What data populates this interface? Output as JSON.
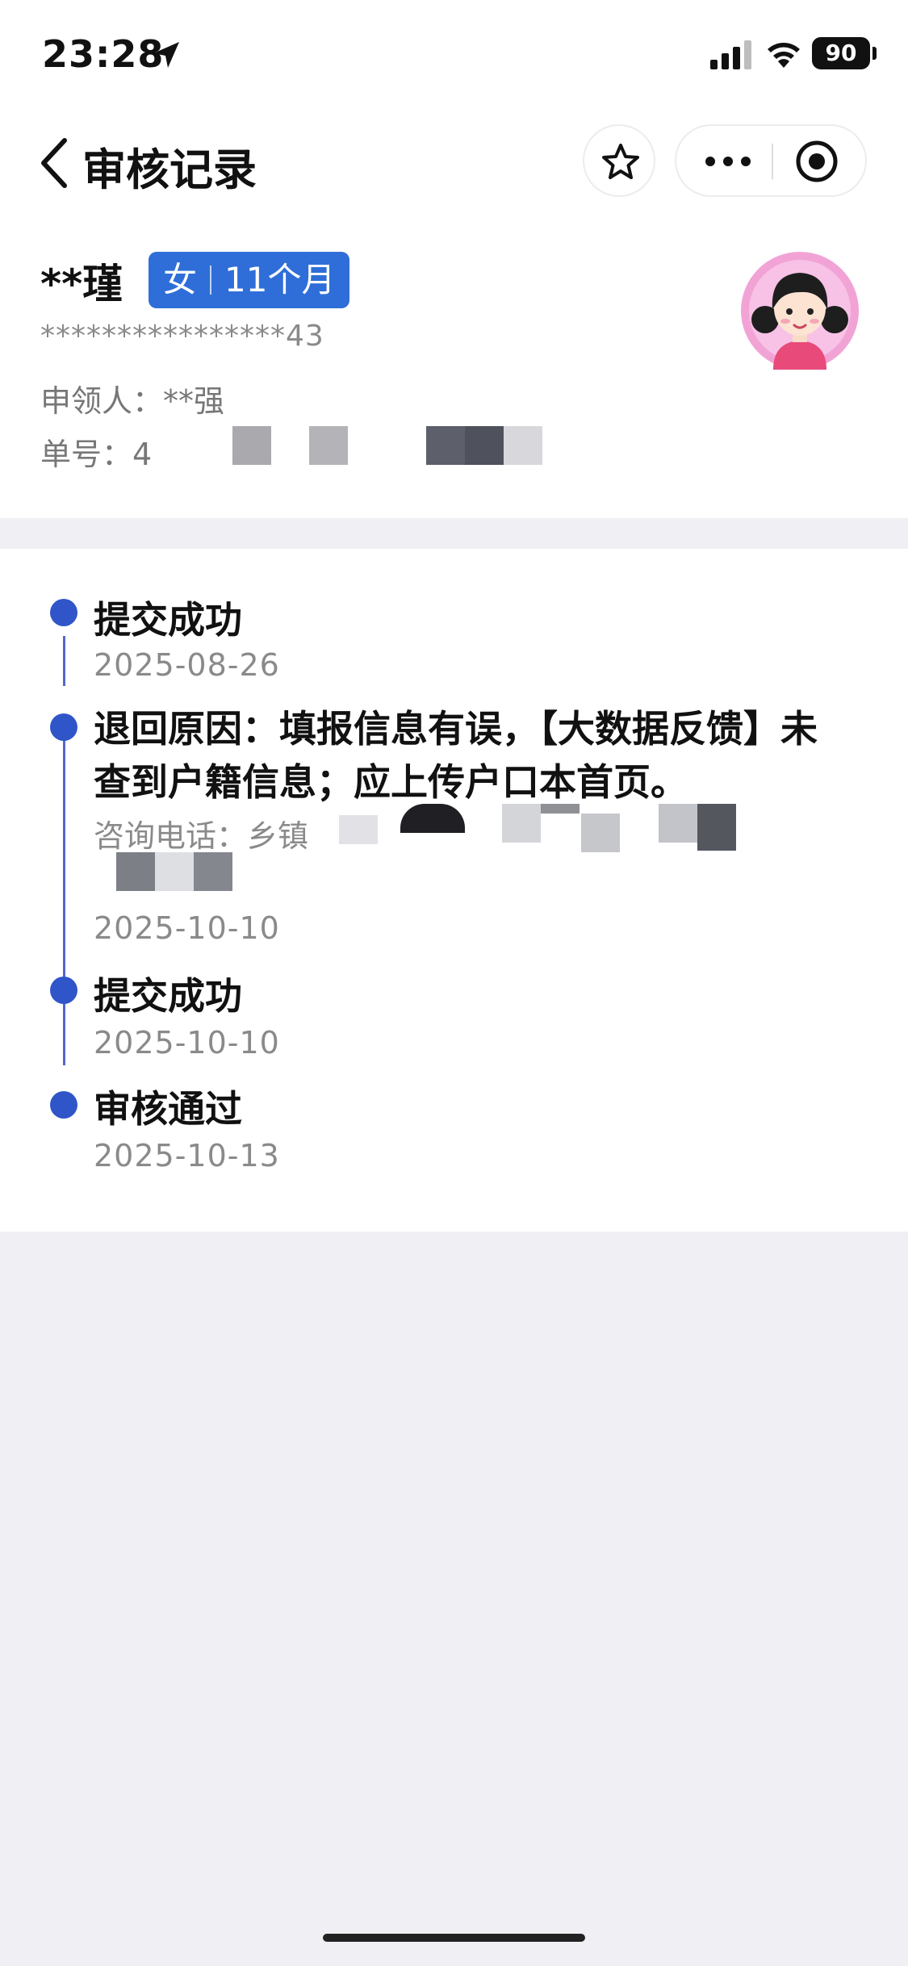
{
  "status_bar": {
    "time": "23:28",
    "battery": "90",
    "icons": [
      "location-arrow-icon",
      "signal-icon",
      "wifi-icon",
      "battery-icon"
    ]
  },
  "nav": {
    "title": "审核记录",
    "icons": [
      "back-chevron-icon",
      "star-icon",
      "more-icon",
      "target-icon"
    ]
  },
  "profile": {
    "name": "**瑾",
    "gender": "女",
    "age": "11个月",
    "id_number": "****************43",
    "applicant_label": "申领人：",
    "applicant_value": "**强",
    "order_label": "单号：",
    "order_value": "4",
    "tag_color": "#2f6ed8",
    "avatar": "girl-avatar-icon"
  },
  "timeline": {
    "accent_color": "#2f55c8",
    "items": [
      {
        "title": "提交成功",
        "date": "2025-08-26"
      },
      {
        "reason": "退回原因：填报信息有误，【大数据反馈】未查到户籍信息；应上传户口本首页。",
        "phone_label": "咨询电话：乡镇",
        "date": "2025-10-10"
      },
      {
        "title": "提交成功",
        "date": "2025-10-10"
      },
      {
        "title": "审核通过",
        "date": "2025-10-13"
      }
    ]
  }
}
